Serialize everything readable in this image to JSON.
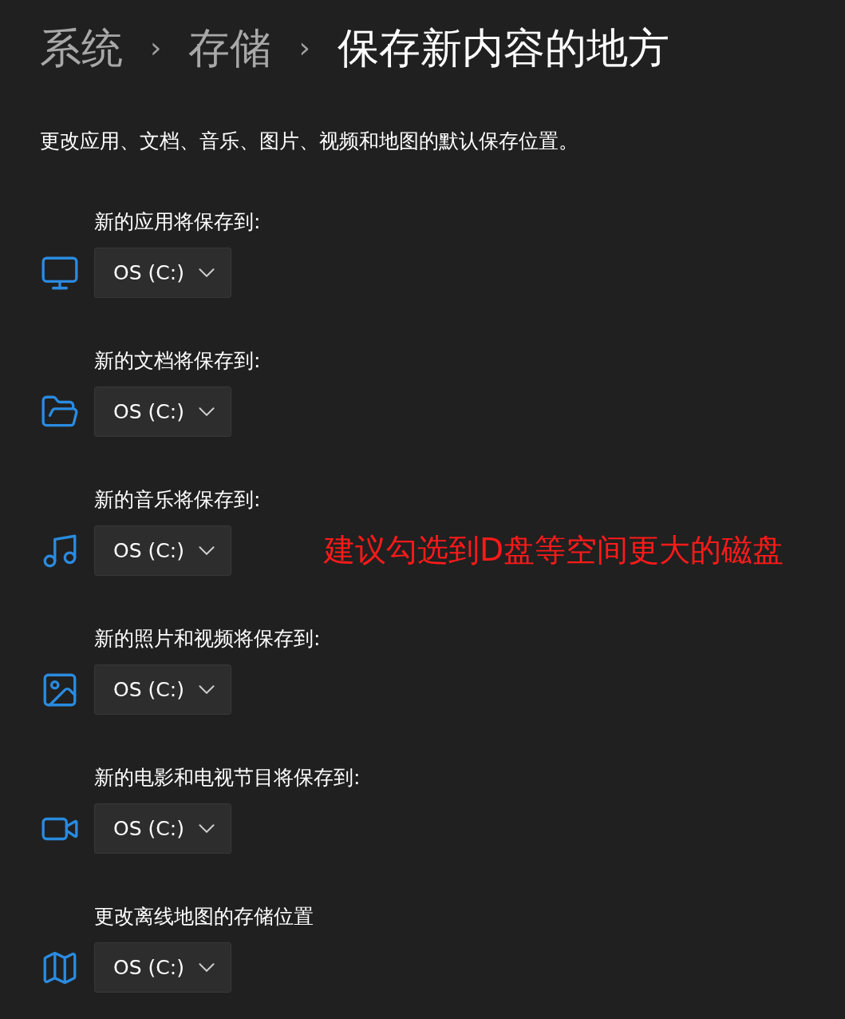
{
  "breadcrumb": {
    "separator": "›",
    "items": [
      {
        "label": "系统",
        "current": false
      },
      {
        "label": "存储",
        "current": false
      },
      {
        "label": "保存新内容的地方",
        "current": true
      }
    ]
  },
  "description": "更改应用、文档、音乐、图片、视频和地图的默认保存位置。",
  "locations": [
    {
      "kind": "apps",
      "label": "新的应用将保存到:",
      "value": "OS (C:)"
    },
    {
      "kind": "documents",
      "label": "新的文档将保存到:",
      "value": "OS (C:)"
    },
    {
      "kind": "music",
      "label": "新的音乐将保存到:",
      "value": "OS (C:)",
      "annotation": "建议勾选到D盘等空间更大的磁盘"
    },
    {
      "kind": "photos",
      "label": "新的照片和视频将保存到:",
      "value": "OS (C:)"
    },
    {
      "kind": "movies",
      "label": "新的电影和电视节目将保存到:",
      "value": "OS (C:)"
    },
    {
      "kind": "maps",
      "label": "更改离线地图的存储位置",
      "value": "OS (C:)"
    }
  ]
}
